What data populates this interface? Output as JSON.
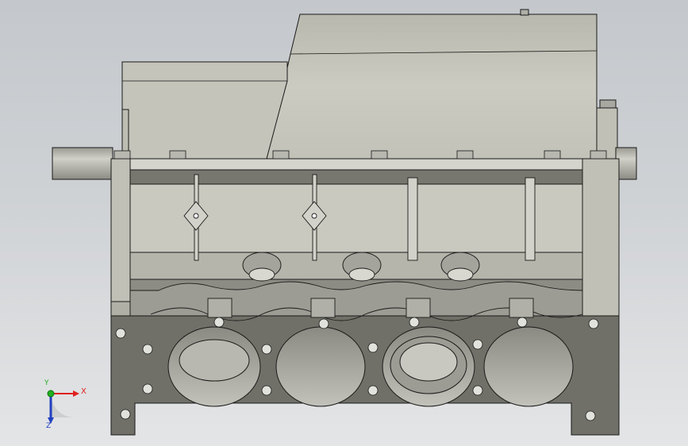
{
  "viewport": {
    "background_top": "#c4c8cc",
    "background_bottom": "#e4e5e7"
  },
  "model": {
    "part_name": "engine-block-front-view",
    "body_color": "#c7c7bd",
    "shadow_color": "#8e8e86",
    "dark_face_color": "#6e6e68",
    "edge_color": "#1a1a1a"
  },
  "triad": {
    "x_label": "X",
    "y_label": "Y",
    "z_label": "Z",
    "x_color": "#e02020",
    "y_color": "#20b020",
    "z_color": "#2040c0"
  }
}
